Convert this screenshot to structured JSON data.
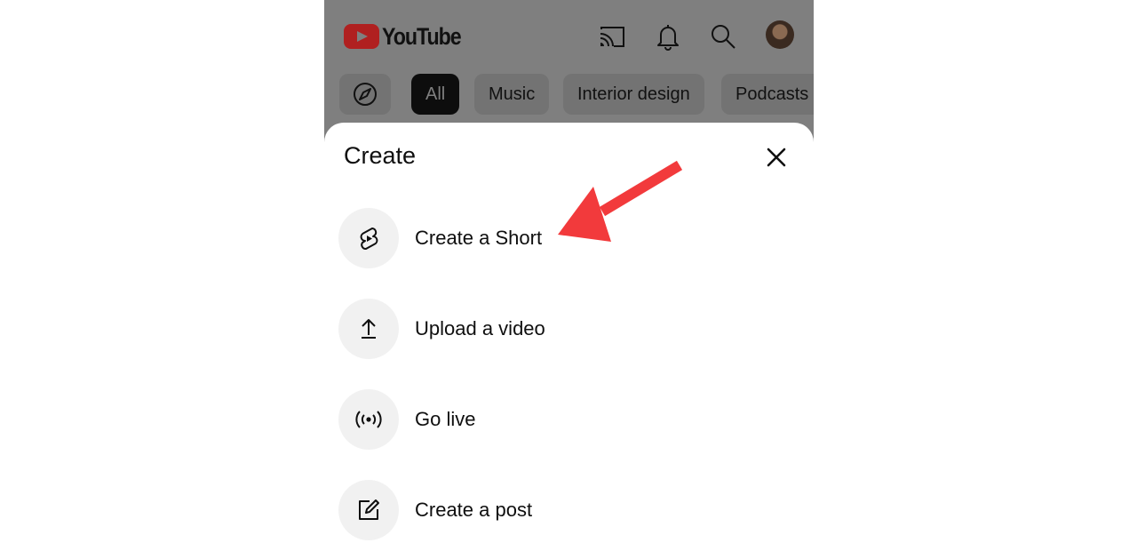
{
  "header": {
    "logo_text": "YouTube",
    "icons": [
      "cast-icon",
      "notifications-bell-icon",
      "search-icon",
      "avatar"
    ]
  },
  "chips": [
    {
      "label": "",
      "icon": "explore-compass-icon"
    },
    {
      "label": "All",
      "selected": true
    },
    {
      "label": "Music"
    },
    {
      "label": "Interior design"
    },
    {
      "label": "Podcasts"
    }
  ],
  "sheet": {
    "title": "Create",
    "close_icon": "close-icon",
    "options": [
      {
        "label": "Create a Short",
        "icon": "shorts-icon"
      },
      {
        "label": "Upload a video",
        "icon": "upload-icon"
      },
      {
        "label": "Go live",
        "icon": "live-broadcast-icon"
      },
      {
        "label": "Create a post",
        "icon": "edit-post-icon"
      }
    ]
  },
  "annotation": {
    "arrow_color": "#f23a3c",
    "points_to": "Create a Short"
  },
  "colors": {
    "overlay_gray": "#7f7f7f",
    "sheet_bg": "#ffffff",
    "option_circle": "#f1f1f1",
    "text": "#0f0f0f"
  }
}
